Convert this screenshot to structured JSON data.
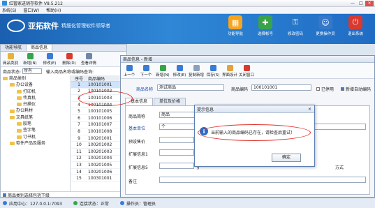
{
  "app": {
    "title": "红管家进销存软件 V8.5.212",
    "menu": [
      "系统(S)",
      "窗口(W)",
      "帮助(H)"
    ],
    "win_controls": [
      "—",
      "□",
      "×"
    ]
  },
  "banner": {
    "brand": "亚拓软件",
    "slogan": "精细化管理软件领导者",
    "buttons": [
      {
        "label": "功能导航",
        "icon": "grid-icon",
        "color": "#f7a51e"
      },
      {
        "label": "选择帐号",
        "icon": "account-icon",
        "color": "#3aa34a"
      },
      {
        "label": "修改密码",
        "icon": "key-icon",
        "color": "#2777c9"
      },
      {
        "label": "更换操作员",
        "icon": "user-icon",
        "color": "#3678c8"
      },
      {
        "label": "退出系统",
        "icon": "power-icon",
        "color": "#d9392e"
      }
    ]
  },
  "left": {
    "tabs": [
      "功能导航",
      "商品信息"
    ],
    "toolbar": [
      {
        "label": "商品类别",
        "color": "#e6b23a"
      },
      {
        "label": "新增(N)",
        "color": "#36a54a"
      },
      {
        "label": "修改(E)",
        "color": "#3a7bd5"
      },
      {
        "label": "删除(D)",
        "color": "#d9392e"
      },
      {
        "label": "查看详情",
        "color": "#6f86a8"
      }
    ],
    "status_label": "商品状态:",
    "status_value": "所有",
    "search_label": "输入商品名称或编码查询:",
    "tree": [
      {
        "label": "商品类别",
        "indent": 0
      },
      {
        "label": "办公设备",
        "indent": 1
      },
      {
        "label": "打印机",
        "indent": 2
      },
      {
        "label": "传真机",
        "indent": 2
      },
      {
        "label": "扫描仪",
        "indent": 2
      },
      {
        "label": "办公耗材",
        "indent": 1
      },
      {
        "label": "文具纸笔",
        "indent": 1
      },
      {
        "label": "胶笔",
        "indent": 2
      },
      {
        "label": "签字笔",
        "indent": 2
      },
      {
        "label": "订书机",
        "indent": 2
      },
      {
        "label": "软件产品及服务",
        "indent": 1
      }
    ],
    "grid_headers": [
      "序号",
      "商品编码"
    ],
    "grid_rows": [
      [
        "1",
        "100101001"
      ],
      [
        "2",
        "100101002"
      ],
      [
        "3",
        "100101003"
      ],
      [
        "4",
        "100101004"
      ],
      [
        "5",
        "100101005"
      ],
      [
        "6",
        "100101006"
      ],
      [
        "7",
        "100101007"
      ],
      [
        "8",
        "100101008"
      ],
      [
        "9",
        "100201001"
      ],
      [
        "10",
        "100201002"
      ],
      [
        "11",
        "100201003"
      ],
      [
        "12",
        "100201004"
      ],
      [
        "13",
        "100201005"
      ],
      [
        "14",
        "100201006"
      ],
      [
        "15",
        "100301001"
      ]
    ],
    "footer": "商品类别选择包括下级"
  },
  "win": {
    "title": "商品信息 - 新增",
    "toolbar": [
      {
        "label": "上一个",
        "color": "#3a7bd5"
      },
      {
        "label": "下一个",
        "color": "#3a7bd5"
      },
      {
        "label": "新增(N)",
        "color": "#36a54a"
      },
      {
        "label": "修改(E)",
        "color": "#3a7bd5"
      },
      {
        "label": "复制新增",
        "color": "#8ba0bf"
      },
      {
        "label": "保存(S)",
        "color": "#3a7bd5"
      },
      {
        "label": "界面设计",
        "color": "#e6a23a"
      },
      {
        "label": "关闭窗口",
        "color": "#d9392e"
      }
    ],
    "name_label": "商品名称",
    "name_value": "测试商品",
    "code_label": "商品编码",
    "code_value": "100101001",
    "stop_label": "已停用",
    "auto_label": "新增自动编码",
    "tabs": [
      "基本信息",
      "单位及价格"
    ],
    "fields": [
      {
        "label": "商品简称",
        "value": "商品"
      },
      {
        "label": "基本单位",
        "value": "个"
      },
      {
        "label": "预设售价",
        "value": ""
      },
      {
        "label": "扩展信息1",
        "value": ""
      },
      {
        "label": "扩展信息5",
        "value": ""
      },
      {
        "label": "备注",
        "value": ""
      }
    ],
    "ext_labels": [
      "扩",
      "扩"
    ],
    "ext_right": "方式"
  },
  "dialog": {
    "title": "提示信息",
    "close": "×",
    "icon": "info-icon",
    "message": "当前输入的商品编码已存在，请检查后重试！",
    "ok": "确定"
  },
  "status": {
    "center": "应用中心：127.0.0.1:7093",
    "conn": "连接状态：正常",
    "user": "操作员：管理员"
  }
}
